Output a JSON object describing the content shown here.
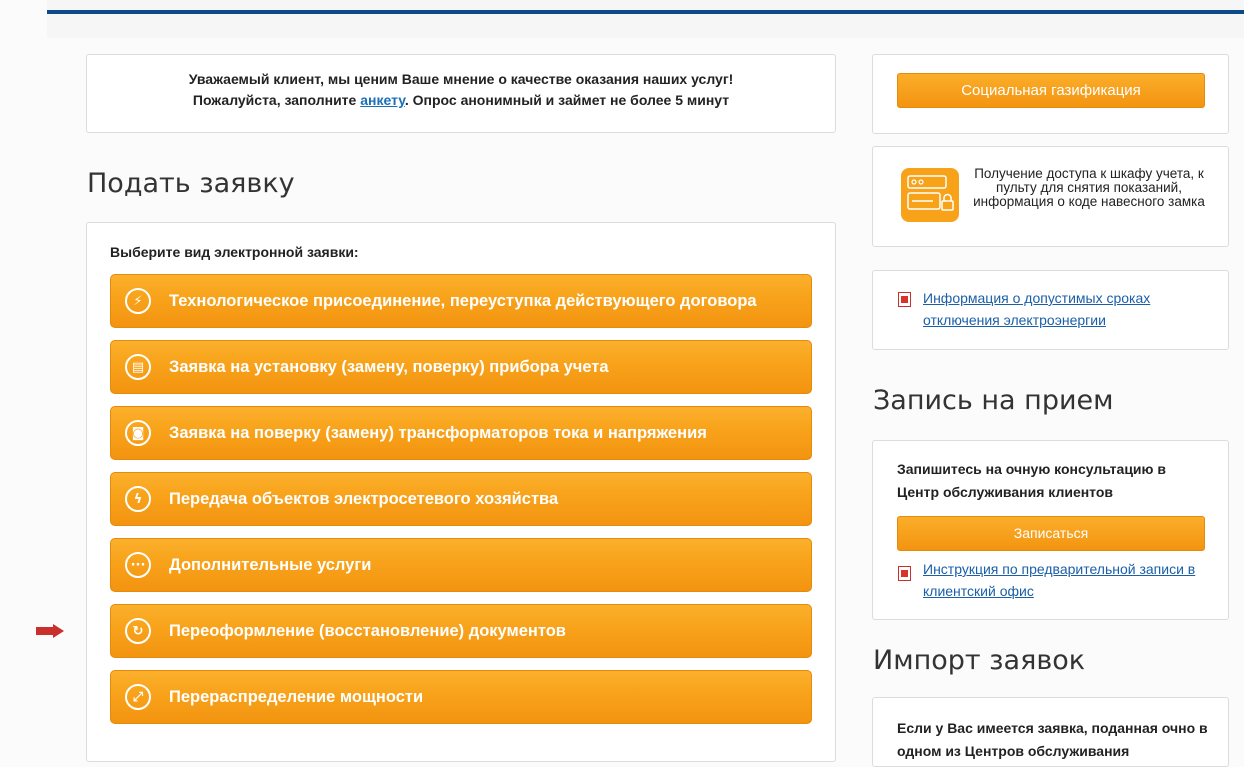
{
  "survey": {
    "line1": "Уважаемый клиент, мы ценим Ваше мнение о качестве оказания наших услуг!",
    "line2_before": "Пожалуйста, заполните ",
    "link": "анкету",
    "line2_after": ". Опрос анонимный и займет не более 5 минут"
  },
  "apply": {
    "title": "Подать заявку",
    "prompt": "Выберите вид электронной заявки:",
    "buttons": [
      {
        "label": "Технологическое присоединение, переуступка действующего договора",
        "icon": "lightning-icon"
      },
      {
        "label": "Заявка на установку (замену, поверку) прибора учета",
        "icon": "meter-icon"
      },
      {
        "label": "Заявка на поверку (замену) трансформаторов тока и напряжения",
        "icon": "transformer-icon"
      },
      {
        "label": "Передача объектов электросетевого хозяйства",
        "icon": "transfer-icon"
      },
      {
        "label": "Дополнительные услуги",
        "icon": "more-icon"
      },
      {
        "label": "Переоформление (восстановление) документов",
        "icon": "refresh-icon"
      },
      {
        "label": "Перераспределение мощности",
        "icon": "redistribute-icon"
      }
    ]
  },
  "sidebar": {
    "social_btn": "Социальная газификация",
    "access_text": "Получение доступа к шкафу учета, к пульту для снятия показаний, информация о коде навесного замка",
    "outage_link": "Информация о допустимых сроках отключения электроэнергии",
    "appointment_title": "Запись на прием",
    "appointment_text": "Запишитесь на очную консультацию в Центр обслуживания клиентов",
    "appointment_btn": "Записаться",
    "instruction_link": "Инструкция по предварительной записи в клиентский офис",
    "import_title": "Импорт заявок",
    "import_text": "Если у Вас имеется заявка, поданная очно в одном из Центров обслуживания"
  },
  "colors": {
    "accent": "#f8a21a",
    "header": "#0d4a8a",
    "link": "#1a5fa8",
    "arrow": "#c9302c"
  }
}
